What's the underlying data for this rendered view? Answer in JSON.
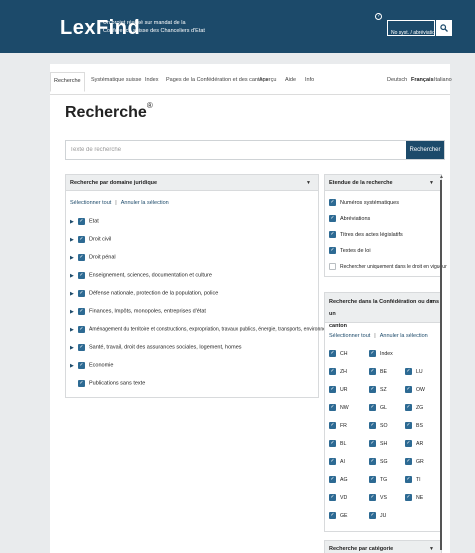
{
  "header": {
    "logo_text": "LexFind",
    "subtitle_line1": "Un projet réalisé sur mandat de la",
    "subtitle_line2": "Conférence suisse des Chanceliers d'Etat",
    "help_icon": "?",
    "search_placeholder": "No syst. / abréviation",
    "search_value": "",
    "colors": {
      "topbar": "#1c4a6a",
      "accent": "#2d6a93"
    }
  },
  "nav": {
    "tabs": [
      "Recherche",
      "Systématique suisse",
      "Index",
      "Pages de la Confédération et des cantons",
      "Aperçu",
      "Aide",
      "Info"
    ],
    "active_tab": "Recherche",
    "languages": [
      "Deutsch",
      "Français",
      "Italiano"
    ],
    "active_language": "Français"
  },
  "page": {
    "title": "Recherche",
    "title_mark": "®",
    "search_placeholder": "Texte de recherche",
    "search_value": "",
    "search_button": "Rechercher"
  },
  "domain_panel": {
    "title": "Recherche par domaine juridique",
    "select_all": "Sélectionner tout",
    "cancel_selection": "Annuler la sélection",
    "items": [
      {
        "label": "Etat",
        "expandable": true,
        "checked": true
      },
      {
        "label": "Droit civil",
        "expandable": true,
        "checked": true
      },
      {
        "label": "Droit pénal",
        "expandable": true,
        "checked": true
      },
      {
        "label": "Enseignement, sciences, documentation et culture",
        "expandable": true,
        "checked": true
      },
      {
        "label": "Défense nationale, protection de la population, police",
        "expandable": true,
        "checked": true
      },
      {
        "label": "Finances, Impôts, monopoles, entreprises d'état",
        "expandable": true,
        "checked": true
      },
      {
        "label": "Aménagement du territoire et constructions, expropriation, travaux publics, énergie, transports, environnement",
        "expandable": true,
        "checked": true
      },
      {
        "label": "Santé, travail, droit des assurances sociales, logement, homes",
        "expandable": true,
        "checked": true
      },
      {
        "label": "Economie",
        "expandable": true,
        "checked": true
      },
      {
        "label": "Publications sans texte",
        "expandable": false,
        "checked": true
      }
    ]
  },
  "scope_panel": {
    "title": "Etendue de la recherche",
    "items": [
      {
        "label": "Numéros systématiques",
        "checked": true
      },
      {
        "label": "Abréviations",
        "checked": true
      },
      {
        "label": "Titres des actes législatifs",
        "checked": true
      },
      {
        "label": "Textes de loi",
        "checked": true
      },
      {
        "label": "Rechercher uniquement dans le droit en vigueur",
        "checked": false
      }
    ]
  },
  "canton_panel": {
    "title_line1": "Recherche dans la Confédération ou dans un",
    "title_line2": "canton",
    "select_all": "Sélectionner tout",
    "cancel_selection": "Annuler la sélection",
    "rows": [
      [
        "CH",
        "Index",
        ""
      ],
      [
        "ZH",
        "BE",
        "LU"
      ],
      [
        "UR",
        "SZ",
        "OW"
      ],
      [
        "NW",
        "GL",
        "ZG"
      ],
      [
        "FR",
        "SO",
        "BS"
      ],
      [
        "BL",
        "SH",
        "AR"
      ],
      [
        "AI",
        "SG",
        "GR"
      ],
      [
        "AG",
        "TG",
        "TI"
      ],
      [
        "VD",
        "VS",
        "NE"
      ],
      [
        "GE",
        "JU",
        ""
      ]
    ]
  },
  "category_panel": {
    "title": "Recherche par catégorie"
  },
  "icons": {
    "check": "✓",
    "expand": "▶",
    "collapse": "▼"
  }
}
